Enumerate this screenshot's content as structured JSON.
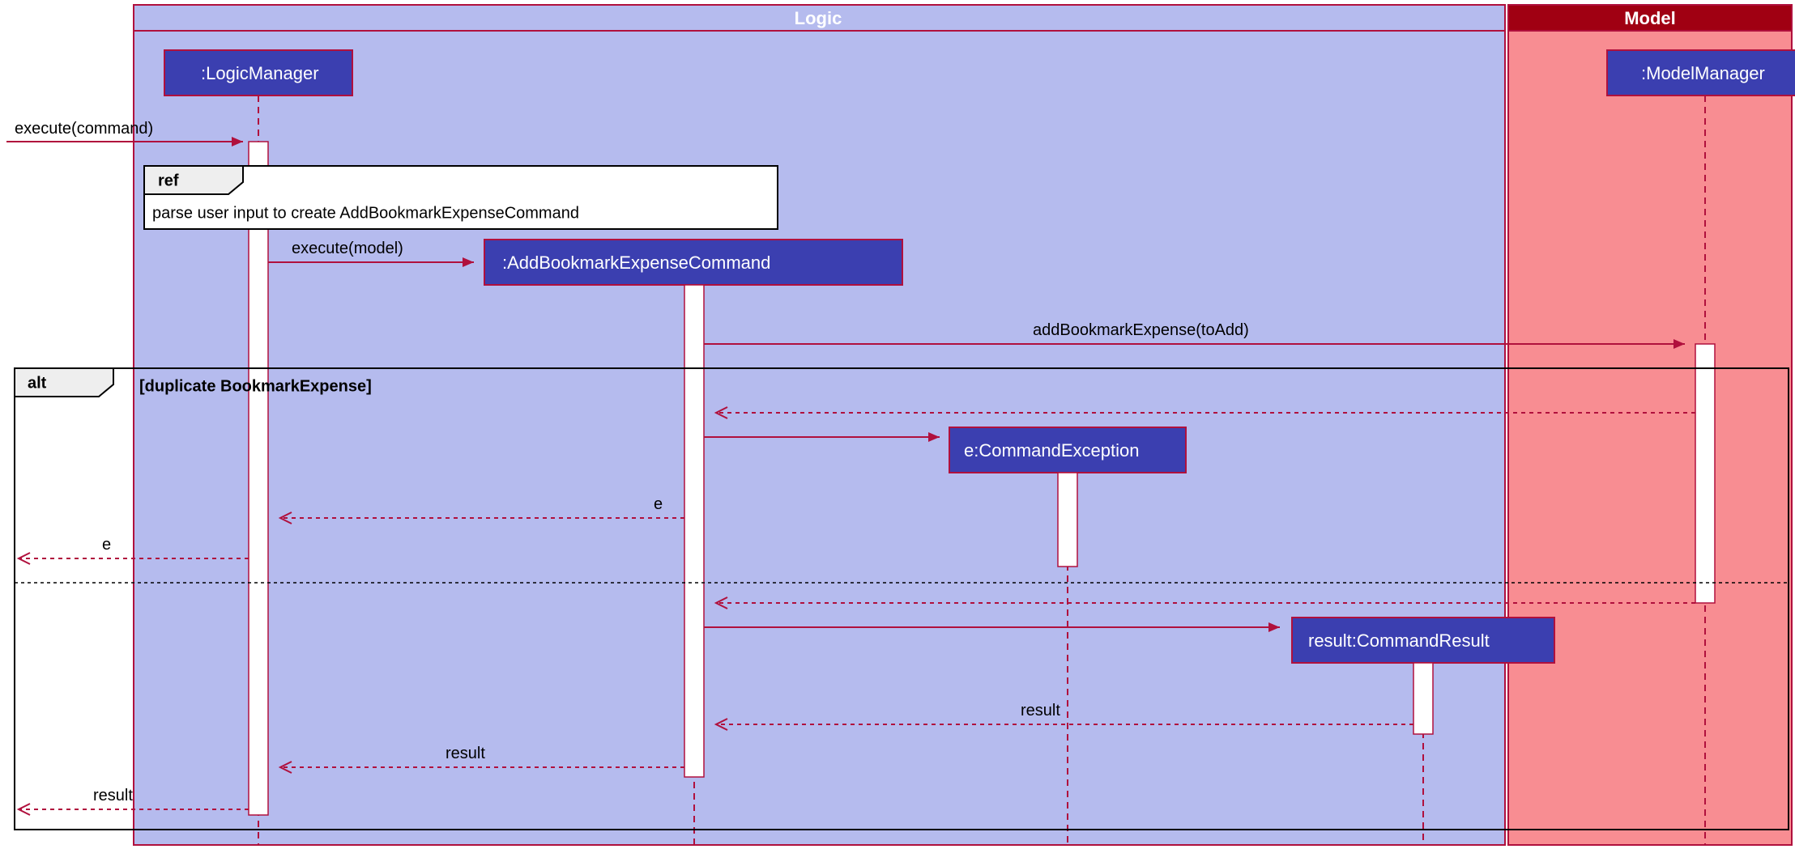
{
  "groups": {
    "logic": "Logic",
    "model": "Model"
  },
  "participants": {
    "logicManager": ":LogicManager",
    "addCommand": ":AddBookmarkExpenseCommand",
    "commandException": "e:CommandException",
    "commandResult": "result:CommandResult",
    "modelManager": ":ModelManager"
  },
  "ref": {
    "tag": "ref",
    "text": "parse user input to create AddBookmarkExpenseCommand"
  },
  "alt": {
    "tag": "alt",
    "guard": "[duplicate BookmarkExpense]"
  },
  "messages": {
    "executeCommand": "execute(command)",
    "executeModel": "execute(model)",
    "addBookmark": "addBookmarkExpense(toAdd)",
    "eReturn1": "e",
    "eReturn2": "e",
    "resultReturn1": "result",
    "resultReturn2": "result",
    "resultReturn3": "result"
  }
}
